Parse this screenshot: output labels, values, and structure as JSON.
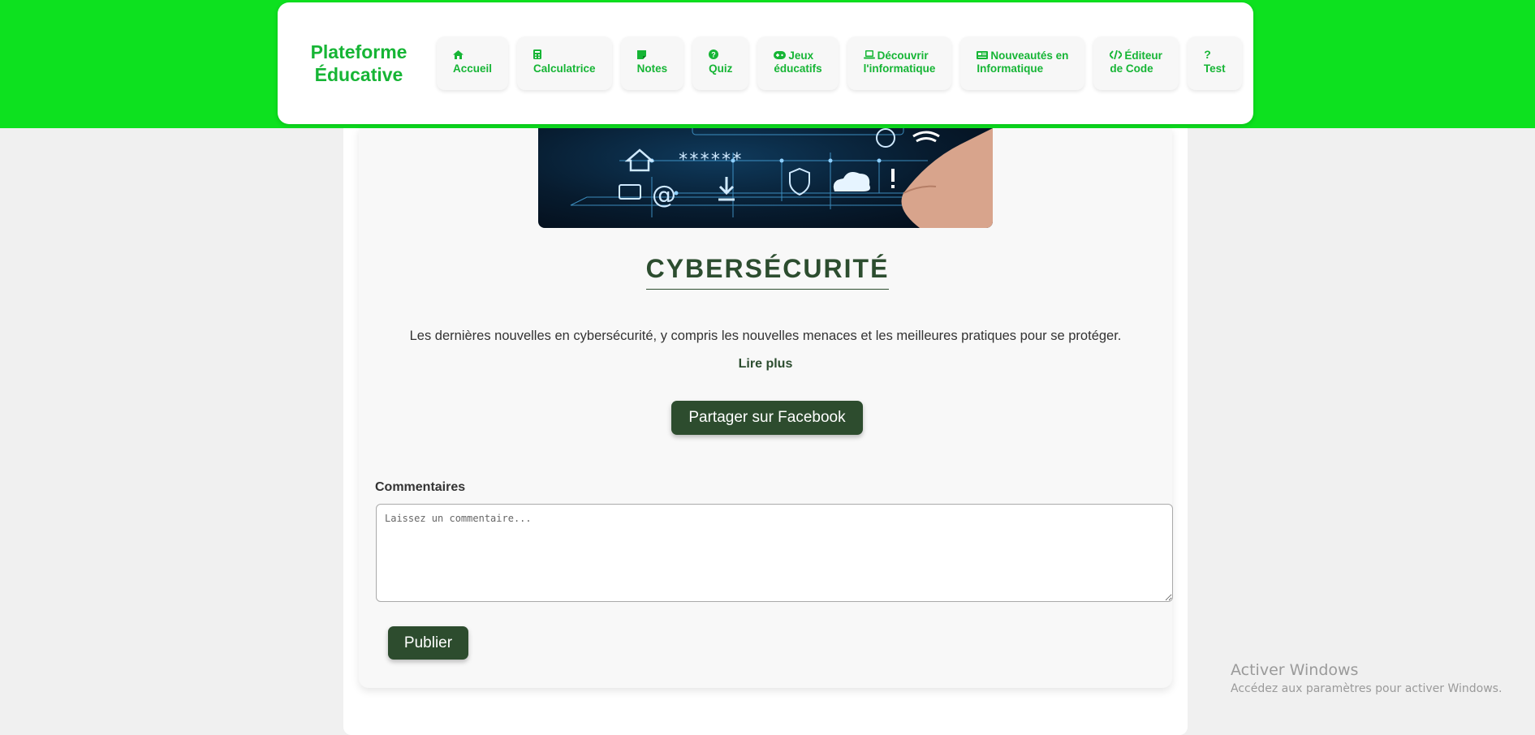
{
  "header": {
    "brand": "Plateforme Éducative",
    "nav": [
      {
        "icon": "home-icon",
        "label": "Accueil"
      },
      {
        "icon": "calculator-icon",
        "label": "Calculatrice"
      },
      {
        "icon": "sticky-note-icon",
        "label": "Notes"
      },
      {
        "icon": "question-circle-icon",
        "label": "Quiz"
      },
      {
        "icon": "gamepad-icon",
        "label": "Jeux éducatifs"
      },
      {
        "icon": "laptop-icon",
        "label": "Découvrir l'informatique"
      },
      {
        "icon": "newspaper-icon",
        "label": "Nouveautés en Informatique"
      },
      {
        "icon": "code-icon",
        "label": "Éditeur de Code"
      },
      {
        "icon": "question-icon",
        "label": "Test"
      }
    ]
  },
  "article": {
    "title": "CYBERSÉCURITÉ",
    "description": "Les dernières nouvelles en cybersécurité, y compris les nouvelles menaces et les meilleures pratiques pour se protéger.",
    "read_more": "Lire plus",
    "share_label": "Partager sur Facebook",
    "image_mask_text": "******"
  },
  "comments": {
    "label": "Commentaires",
    "placeholder": "Laissez un commentaire...",
    "value": "",
    "publish_label": "Publier"
  },
  "watermark": {
    "title": "Activer Windows",
    "subtitle": "Accédez aux paramètres pour activer Windows."
  },
  "colors": {
    "band": "#0de11f",
    "brand_green": "#16b535",
    "button_dark_green": "#2d4c2e"
  }
}
